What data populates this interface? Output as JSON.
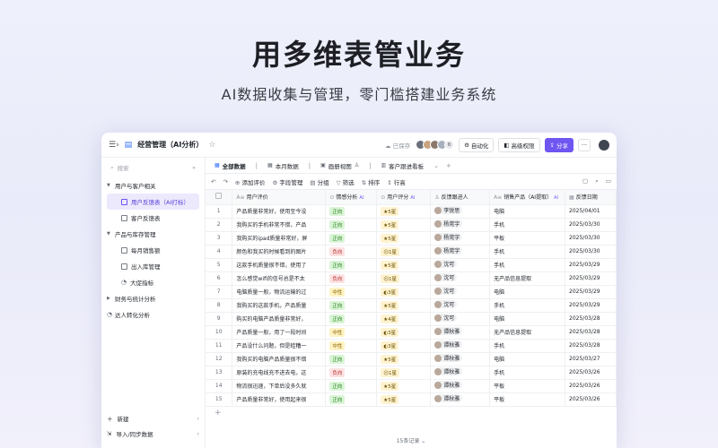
{
  "hero": {
    "title": "用多维表管业务",
    "subtitle": "AI数据收集与管理，零门槛搭建业务系统"
  },
  "window": {
    "doc_title": "经营管理（AI分析）",
    "saved": "已保存",
    "collab_count": "6",
    "buttons": {
      "automation": "自动化",
      "permissions": "高级权限",
      "share": "分享",
      "more": "···"
    }
  },
  "sidebar": {
    "search_placeholder": "搜索",
    "groups": [
      {
        "label": "用户与客户相关",
        "items": [
          "用户反馈表（AI打标）",
          "客户反馈表"
        ]
      },
      {
        "label": "产品与库存管理",
        "items": [
          "每月销售额",
          "出入库管理",
          "大促指标"
        ]
      },
      {
        "label": "财务与统计分析",
        "items": []
      }
    ],
    "extra": "达人转化分析",
    "bottom": {
      "new": "新建",
      "import": "导入/同步数据"
    }
  },
  "views": {
    "tabs": [
      "全部数据",
      "本月数据",
      "画册视图",
      "客户跟进看板"
    ]
  },
  "toolbar": {
    "add_record": "添加评价",
    "fields": "字段管理",
    "group": "分组",
    "filter": "筛选",
    "sort": "排序",
    "row_height": "行高"
  },
  "table": {
    "columns": [
      "用户评价",
      "情感分析",
      "用户评分",
      "反馈跟进人",
      "销售产品（AI提取）",
      "反馈日期"
    ],
    "rows": [
      {
        "n": "1",
        "review": "产品质量非常好，使用至今没",
        "sent": "正向",
        "rating": "5星",
        "owner": "李锐思",
        "product": "电脑",
        "date": "2025/04/01"
      },
      {
        "n": "2",
        "review": "我购买的手机非常不错，产品",
        "sent": "正向",
        "rating": "5星",
        "owner": "杨莞宇",
        "product": "手机",
        "date": "2025/03/30"
      },
      {
        "n": "3",
        "review": "我购买的ipad质量非常好，屏",
        "sent": "正向",
        "rating": "5星",
        "owner": "杨莞宇",
        "product": "平板",
        "date": "2025/03/30"
      },
      {
        "n": "4",
        "review": "颜色和我买的时候看到的图片",
        "sent": "负向",
        "rating": "1星",
        "owner": "杨莞宇",
        "product": "手机",
        "date": "2025/03/30"
      },
      {
        "n": "5",
        "review": "这款手机质量很不错，使用了",
        "sent": "正向",
        "rating": "5星",
        "owner": "沈可",
        "product": "手机",
        "date": "2025/03/29"
      },
      {
        "n": "6",
        "review": "怎么感觉wifi的信号总是不太",
        "sent": "负向",
        "rating": "1星",
        "owner": "沈可",
        "product": "无产品信息提取",
        "date": "2025/03/29"
      },
      {
        "n": "7",
        "review": "电脑质量一般，物流运输的过",
        "sent": "中性",
        "rating": "3星",
        "owner": "沈可",
        "product": "电脑",
        "date": "2025/03/29"
      },
      {
        "n": "8",
        "review": "我购买的这款手机，产品质量",
        "sent": "正向",
        "rating": "5星",
        "owner": "沈可",
        "product": "手机",
        "date": "2025/03/29"
      },
      {
        "n": "9",
        "review": "购买的电脑产品质量非常好，",
        "sent": "正向",
        "rating": "4星",
        "owner": "沈可",
        "product": "电脑",
        "date": "2025/03/28"
      },
      {
        "n": "10",
        "review": "产品质量一般，用了一段时间",
        "sent": "中性",
        "rating": "3星",
        "owner": "谭秋雅",
        "product": "无产品信息提取",
        "date": "2025/03/28"
      },
      {
        "n": "11",
        "review": "产品没什么问题，但是蛙糟一",
        "sent": "中性",
        "rating": "3星",
        "owner": "谭秋雅",
        "product": "手机",
        "date": "2025/03/28"
      },
      {
        "n": "12",
        "review": "我购买的电脑产品质量很不错",
        "sent": "正向",
        "rating": "5星",
        "owner": "谭秋雅",
        "product": "电脑",
        "date": "2025/03/27"
      },
      {
        "n": "13",
        "review": "原装的充电线充不进去电，这",
        "sent": "负向",
        "rating": "1星",
        "owner": "谭秋雅",
        "product": "手机",
        "date": "2025/03/26"
      },
      {
        "n": "14",
        "review": "物流很迅速，下单后没多久就",
        "sent": "正向",
        "rating": "5星",
        "owner": "谭秋雅",
        "product": "平板",
        "date": "2025/03/26"
      },
      {
        "n": "15",
        "review": "产品质量非常好，使用起来很",
        "sent": "正向",
        "rating": "5星",
        "owner": "谭秋雅",
        "product": "平板",
        "date": "2025/03/26"
      }
    ],
    "footer": "15条记录"
  },
  "colors": {
    "accent": "#6f55f2",
    "positive_bg": "#d9f5d6",
    "negative_bg": "#fde2e2",
    "neutral_bg": "#fff3c4"
  }
}
